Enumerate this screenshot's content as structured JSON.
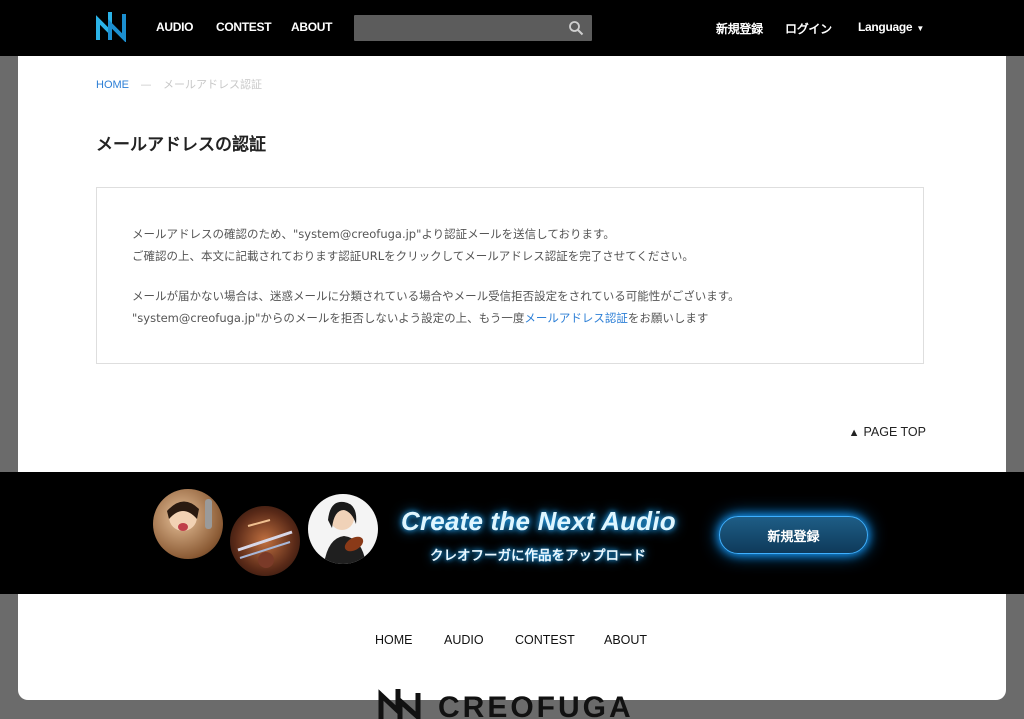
{
  "header": {
    "nav": [
      "AUDIO",
      "CONTEST",
      "ABOUT"
    ],
    "search": {
      "placeholder": "",
      "value": ""
    },
    "signup": "新規登録",
    "login": "ログイン",
    "language": "Language"
  },
  "breadcrumb": {
    "home": "HOME",
    "separator": "—",
    "current": "メールアドレス認証"
  },
  "page_title": "メールアドレスの認証",
  "message": {
    "line1": "メールアドレスの確認のため、\"system@creofuga.jp\"より認証メールを送信しております。",
    "line2": "ご確認の上、本文に記載されております認証URLをクリックしてメールアドレス認証を完了させてください。",
    "line3": "メールが届かない場合は、迷惑メールに分類されている場合やメール受信拒否設定をされている可能性がございます。",
    "line4_prefix": "\"system@creofuga.jp\"からのメールを拒否しないよう設定の上、もう一度",
    "line4_link": "メールアドレス認証",
    "line4_suffix": "をお願いします"
  },
  "page_top": "PAGE TOP",
  "banner": {
    "headline": "Create the Next Audio",
    "subline": "クレオフーガに作品をアップロード",
    "button": "新規登録"
  },
  "footer": {
    "links": [
      "HOME",
      "AUDIO",
      "CONTEST",
      "ABOUT"
    ],
    "logo_text": "CREOFUGA"
  },
  "colors": {
    "header_bg": "#000000",
    "link_blue": "#2d7fd6",
    "banner_glow": "#2ab0ff",
    "page_bg": "#6b6b6b"
  }
}
